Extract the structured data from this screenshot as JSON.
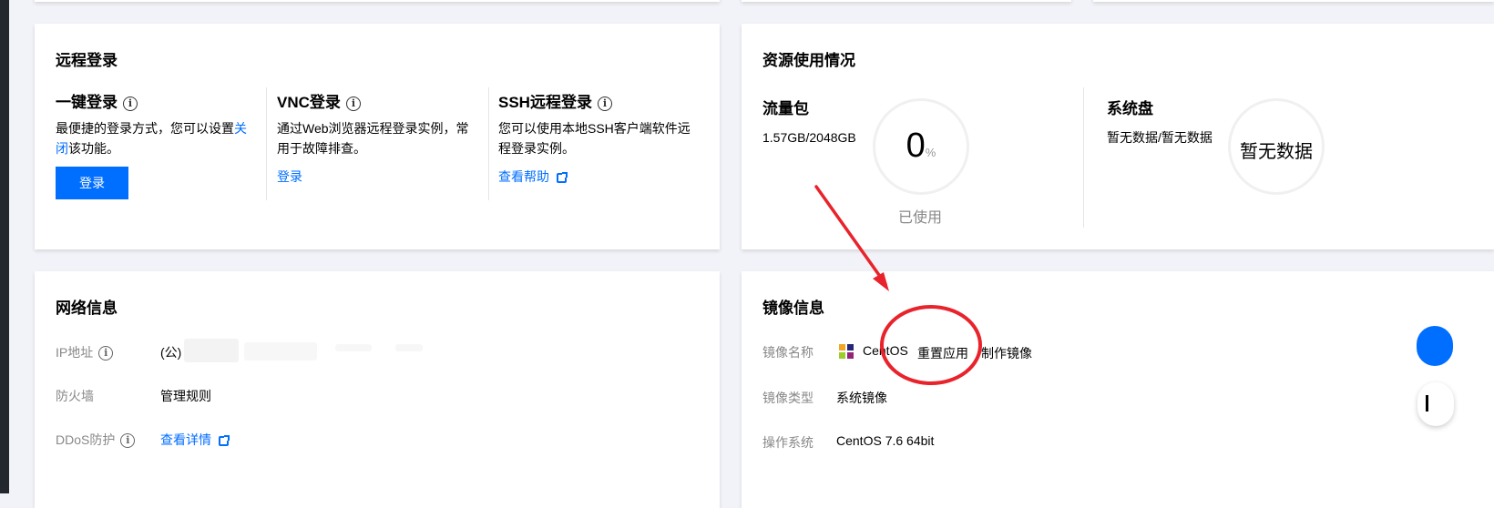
{
  "remote_login": {
    "title": "远程登录",
    "one_click": {
      "title": "一键登录",
      "desc_pre": "最便捷的登录方式，您可以设置",
      "desc_link": "关闭",
      "desc_post": "该功能。",
      "button": "登录"
    },
    "vnc": {
      "title": "VNC登录",
      "desc": "通过Web浏览器远程登录实例，常用于故障排查。",
      "link": "登录"
    },
    "ssh": {
      "title": "SSH远程登录",
      "desc": "您可以使用本地SSH客户端软件远程登录实例。",
      "link": "查看帮助"
    }
  },
  "resource_usage": {
    "title": "资源使用情况",
    "traffic": {
      "title": "流量包",
      "value": "1.57GB/2048GB",
      "percent": "0",
      "percent_unit": "%",
      "used_label": "已使用"
    },
    "disk": {
      "title": "系统盘",
      "value": "暂无数据/暂无数据",
      "ring_text": "暂无数据"
    }
  },
  "network": {
    "title": "网络信息",
    "ip_label": "IP地址",
    "ip_value_prefix": "(公)",
    "firewall_label": "防火墙",
    "firewall_link": "管理规则",
    "ddos_label": "DDoS防护",
    "ddos_link": "查看详情"
  },
  "image": {
    "title": "镜像信息",
    "name_label": "镜像名称",
    "name_value": "CentOS",
    "reset_link": "重置应用",
    "make_link": "制作镜像",
    "type_label": "镜像类型",
    "type_value": "系统镜像",
    "os_label": "操作系统",
    "os_value": "CentOS 7.6 64bit"
  },
  "annotation": {
    "color": "#e8232b"
  },
  "colors": {
    "accent": "#006eff",
    "background": "#f2f3f8"
  }
}
